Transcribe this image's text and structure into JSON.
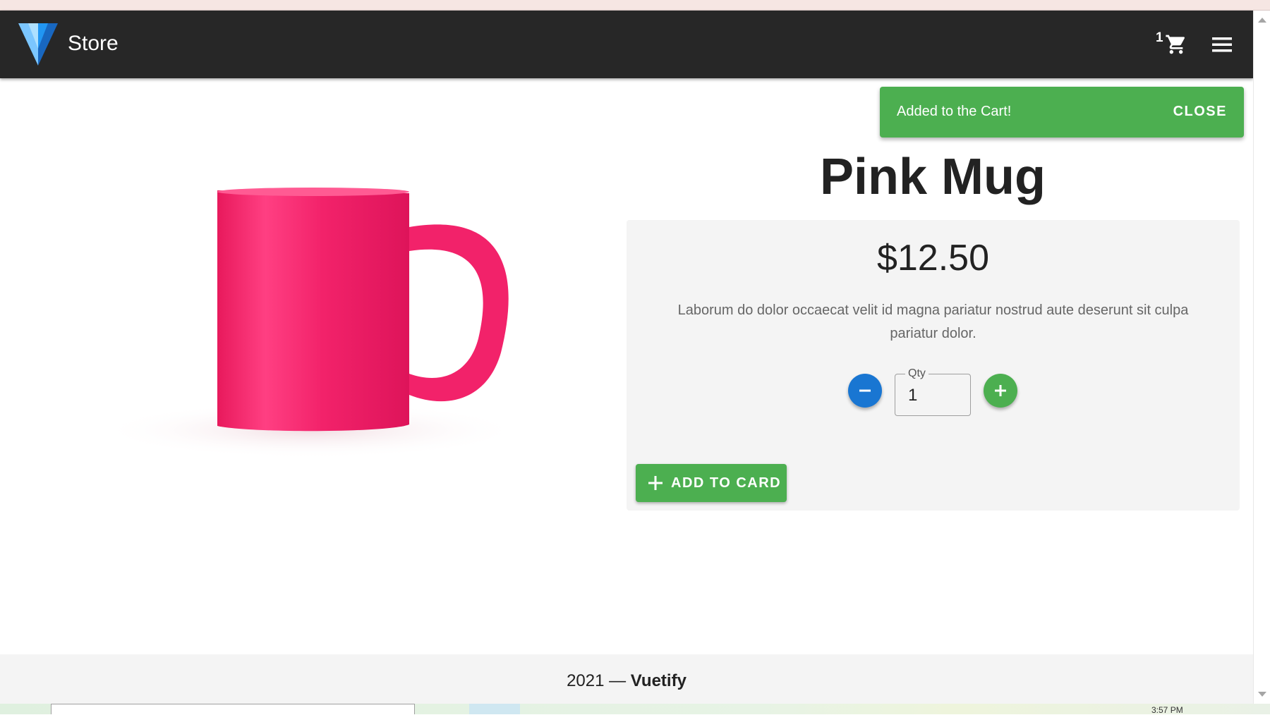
{
  "app": {
    "brand": "Store"
  },
  "cart": {
    "count": "1"
  },
  "snackbar": {
    "message": "Added to the Cart!",
    "close_label": "CLOSE"
  },
  "product": {
    "name": "Pink Mug",
    "price": "$12.50",
    "description": "Laborum do dolor occaecat velit id magna pariatur nostrud aute deserunt sit culpa pariatur dolor.",
    "image_color": "#f2226a"
  },
  "quantity": {
    "label": "Qty",
    "value": "1"
  },
  "actions": {
    "add_label": "ADD TO CARD"
  },
  "footer": {
    "year_text": "2021 —",
    "brand": "Vuetify"
  },
  "taskbar": {
    "clock": "3:57 PM"
  },
  "colors": {
    "appbar": "#272727",
    "success": "#4caf50",
    "primary": "#1976d2",
    "vuetify_light": "#7bc6ff",
    "vuetify_dark": "#1867c0"
  }
}
